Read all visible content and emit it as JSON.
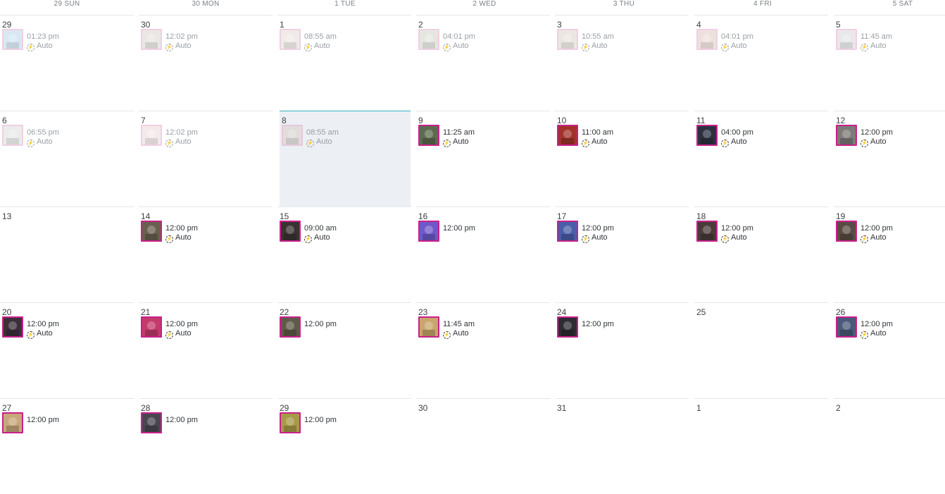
{
  "header": [
    {
      "label": "29 SUN"
    },
    {
      "label": "30 MON"
    },
    {
      "label": "1 TUE"
    },
    {
      "label": "2 WED"
    },
    {
      "label": "3 THU"
    },
    {
      "label": "4 FRI"
    },
    {
      "label": "5 SAT"
    }
  ],
  "colors": {
    "thumb_border": "#c8218a",
    "today_bg": "#eceff4",
    "today_line": "#37b4c8"
  },
  "auto_label": "Auto",
  "weeks": [
    [
      {
        "day": "29",
        "post": {
          "time": "01:23 pm",
          "auto": true,
          "past": true,
          "thumb": "#b9d6ea"
        }
      },
      {
        "day": "30",
        "post": {
          "time": "12:02 pm",
          "auto": true,
          "past": true,
          "thumb": "#d9d4cf"
        }
      },
      {
        "day": "1",
        "post": {
          "time": "08:55 am",
          "auto": true,
          "past": true,
          "thumb": "#e3ddd6"
        }
      },
      {
        "day": "2",
        "post": {
          "time": "04:01 pm",
          "auto": true,
          "past": true,
          "thumb": "#cfd4c8"
        }
      },
      {
        "day": "3",
        "post": {
          "time": "10:55 am",
          "auto": true,
          "past": true,
          "thumb": "#ddd2cc"
        }
      },
      {
        "day": "4",
        "post": {
          "time": "04:01 pm",
          "auto": true,
          "past": true,
          "thumb": "#e0c9c4"
        }
      },
      {
        "day": "5",
        "post": {
          "time": "11:45 am",
          "auto": true,
          "past": true,
          "thumb": "#d6d6d6"
        }
      }
    ],
    [
      {
        "day": "6",
        "post": {
          "time": "06:55 pm",
          "auto": true,
          "past": true,
          "thumb": "#dcdcdc"
        }
      },
      {
        "day": "7",
        "post": {
          "time": "12:02 pm",
          "auto": true,
          "past": true,
          "thumb": "#ecd9dc"
        }
      },
      {
        "day": "8",
        "today": true,
        "post": {
          "time": "08:55 am",
          "auto": true,
          "past": true,
          "thumb": "#d9cfc8"
        }
      },
      {
        "day": "9",
        "post": {
          "time": "11:25 am",
          "auto": true,
          "past": false,
          "thumb": "#5c6b4e"
        }
      },
      {
        "day": "10",
        "post": {
          "time": "11:00 am",
          "auto": true,
          "past": false,
          "thumb": "#a2322b"
        }
      },
      {
        "day": "11",
        "post": {
          "time": "04:00 pm",
          "auto": true,
          "past": false,
          "thumb": "#2b3140"
        }
      },
      {
        "day": "12",
        "post": {
          "time": "12:00 pm",
          "auto": true,
          "past": false,
          "thumb": "#7d7a78"
        }
      }
    ],
    [
      {
        "day": "13"
      },
      {
        "day": "14",
        "post": {
          "time": "12:00 pm",
          "auto": true,
          "past": false,
          "thumb": "#6a5f4e"
        }
      },
      {
        "day": "15",
        "post": {
          "time": "09:00 am",
          "auto": true,
          "past": false,
          "thumb": "#3a3230"
        }
      },
      {
        "day": "16",
        "post": {
          "time": "12:00 pm",
          "auto": false,
          "past": false,
          "thumb": "#6f59c9"
        }
      },
      {
        "day": "17",
        "post": {
          "time": "12:00 pm",
          "auto": true,
          "past": false,
          "thumb": "#4a5da8"
        }
      },
      {
        "day": "18",
        "post": {
          "time": "12:00 pm",
          "auto": true,
          "past": false,
          "thumb": "#4a3a3a"
        }
      },
      {
        "day": "19",
        "post": {
          "time": "12:00 pm",
          "auto": true,
          "past": false,
          "thumb": "#5a4c44"
        }
      }
    ],
    [
      {
        "day": "20",
        "post": {
          "time": "12:00 pm",
          "auto": true,
          "past": false,
          "thumb": "#3d2f3a"
        }
      },
      {
        "day": "21",
        "post": {
          "time": "12:00 pm",
          "auto": true,
          "past": false,
          "thumb": "#c43a6b"
        }
      },
      {
        "day": "22",
        "post": {
          "time": "12:00 pm",
          "auto": false,
          "past": false,
          "thumb": "#5f5a4a"
        }
      },
      {
        "day": "23",
        "post": {
          "time": "11:45 am",
          "auto": true,
          "past": false,
          "thumb": "#c9a66c"
        }
      },
      {
        "day": "24",
        "post": {
          "time": "12:00 pm",
          "auto": false,
          "past": false,
          "thumb": "#2d2b33"
        }
      },
      {
        "day": "25"
      },
      {
        "day": "26",
        "post": {
          "time": "12:00 pm",
          "auto": true,
          "past": false,
          "thumb": "#4b5a7a"
        }
      }
    ],
    [
      {
        "day": "27",
        "post": {
          "time": "12:00 pm",
          "auto": false,
          "past": false,
          "thumb": "#c7a77b"
        }
      },
      {
        "day": "28",
        "post": {
          "time": "12:00 pm",
          "auto": false,
          "past": false,
          "thumb": "#4a4650"
        }
      },
      {
        "day": "29",
        "post": {
          "time": "12:00 pm",
          "auto": false,
          "past": false,
          "thumb": "#a89a48"
        }
      },
      {
        "day": "30"
      },
      {
        "day": "31"
      },
      {
        "day": "1"
      },
      {
        "day": "2"
      }
    ]
  ]
}
